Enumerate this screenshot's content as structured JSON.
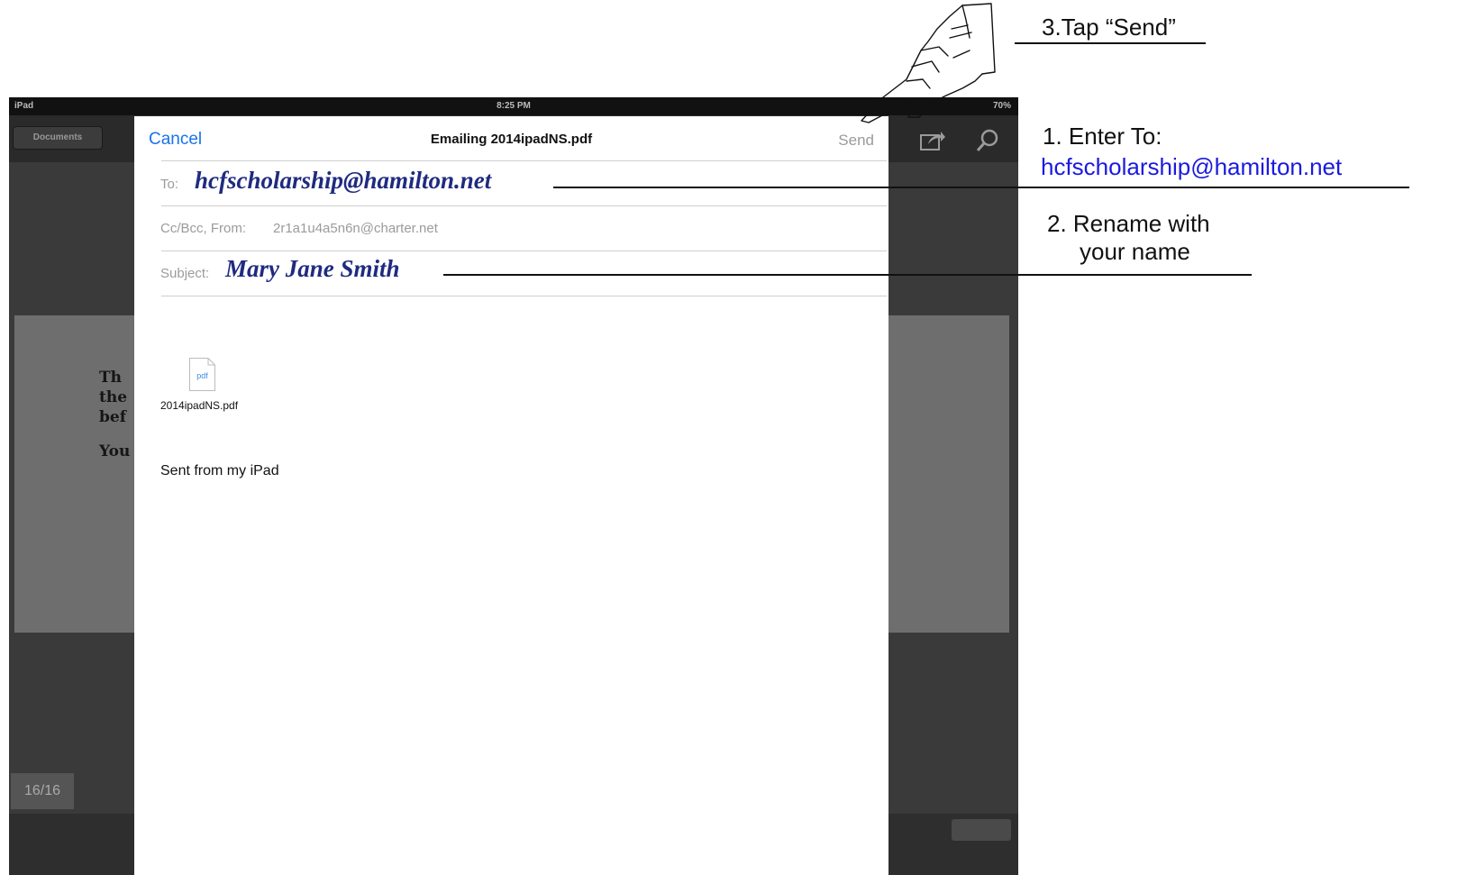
{
  "status_bar": {
    "carrier": "iPad",
    "time": "8:25 PM",
    "battery": "70%"
  },
  "toolbar": {
    "documents_label": "Documents"
  },
  "background_page": {
    "lines": [
      "Th",
      "the",
      "bef",
      "You"
    ],
    "page_indicator": "16/16"
  },
  "compose": {
    "cancel_label": "Cancel",
    "title": "Emailing 2014ipadNS.pdf",
    "send_label": "Send",
    "to_label": "To:",
    "to_value": "hcfscholarship@hamilton.net",
    "cc_label": "Cc/Bcc, From:",
    "cc_value": "2r1a1u4a5n6n@charter.net",
    "subject_label": "Subject:",
    "subject_value": "Mary Jane Smith",
    "attachment_icon_text": "pdf",
    "attachment_name": "2014ipadNS.pdf",
    "signature": "Sent from my iPad"
  },
  "annotations": {
    "step3": "3.Tap “Send”",
    "step1_line1": "1. Enter To:",
    "step1_email": "hcfscholarship@hamilton.net",
    "step2_line1": "2. Rename with",
    "step2_line2": "your name"
  },
  "colors": {
    "link_blue": "#1a73e8",
    "annotation_blue": "#1a1ae0",
    "handwriting_blue": "#1f2b80"
  }
}
